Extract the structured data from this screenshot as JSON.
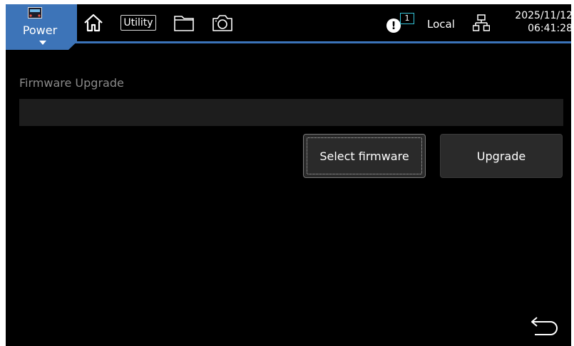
{
  "header": {
    "power_label": "Power",
    "utility_label": "Utility",
    "alert_count": "1",
    "connection_mode": "Local",
    "date": "2025/11/12",
    "time": "06:41:28"
  },
  "main": {
    "section_title": "Firmware Upgrade",
    "path_value": "",
    "select_label": "Select firmware",
    "upgrade_label": "Upgrade"
  },
  "colors": {
    "accent": "#3d74b8",
    "badge_border": "#34c3d8",
    "background": "#000000",
    "field_bg": "#1d1d1d",
    "button_bg": "#2a2a2a"
  },
  "icons": [
    "power-supply-icon",
    "home-icon",
    "folder-icon",
    "camera-icon",
    "alert-icon",
    "network-icon",
    "back-arrow-icon"
  ]
}
